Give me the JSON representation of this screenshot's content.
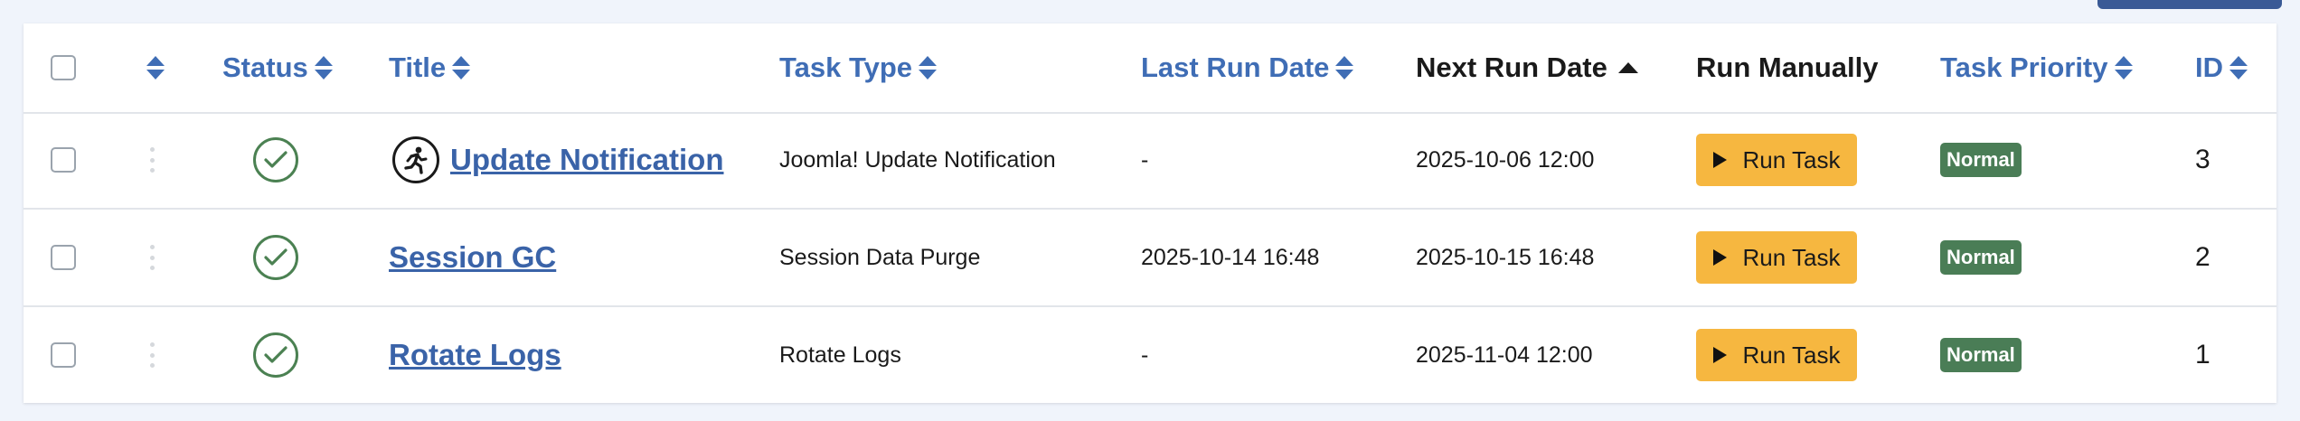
{
  "header": {
    "status": "Status",
    "title": "Title",
    "task_type": "Task Type",
    "last_run_date": "Last Run Date",
    "next_run_date": "Next Run Date",
    "run_manually": "Run Manually",
    "task_priority": "Task Priority",
    "id": "ID"
  },
  "colors": {
    "link": "#3f6db5",
    "status_ok": "#4b8152",
    "run_button": "#f6b740",
    "priority_badge": "#4a7d56"
  },
  "rows": [
    {
      "icon": "runner-icon",
      "title": "Update Notification",
      "task_type": "Joomla! Update Notification",
      "last_run": "-",
      "next_run": "2025-10-06 12:00",
      "run_label": "Run Task",
      "priority": "Normal",
      "id": "3"
    },
    {
      "title": "Session GC",
      "task_type": "Session Data Purge",
      "last_run": "2025-10-14 16:48",
      "next_run": "2025-10-15 16:48",
      "run_label": "Run Task",
      "priority": "Normal",
      "id": "2"
    },
    {
      "title": "Rotate Logs",
      "task_type": "Rotate Logs",
      "last_run": "-",
      "next_run": "2025-11-04 12:00",
      "run_label": "Run Task",
      "priority": "Normal",
      "id": "1"
    }
  ]
}
